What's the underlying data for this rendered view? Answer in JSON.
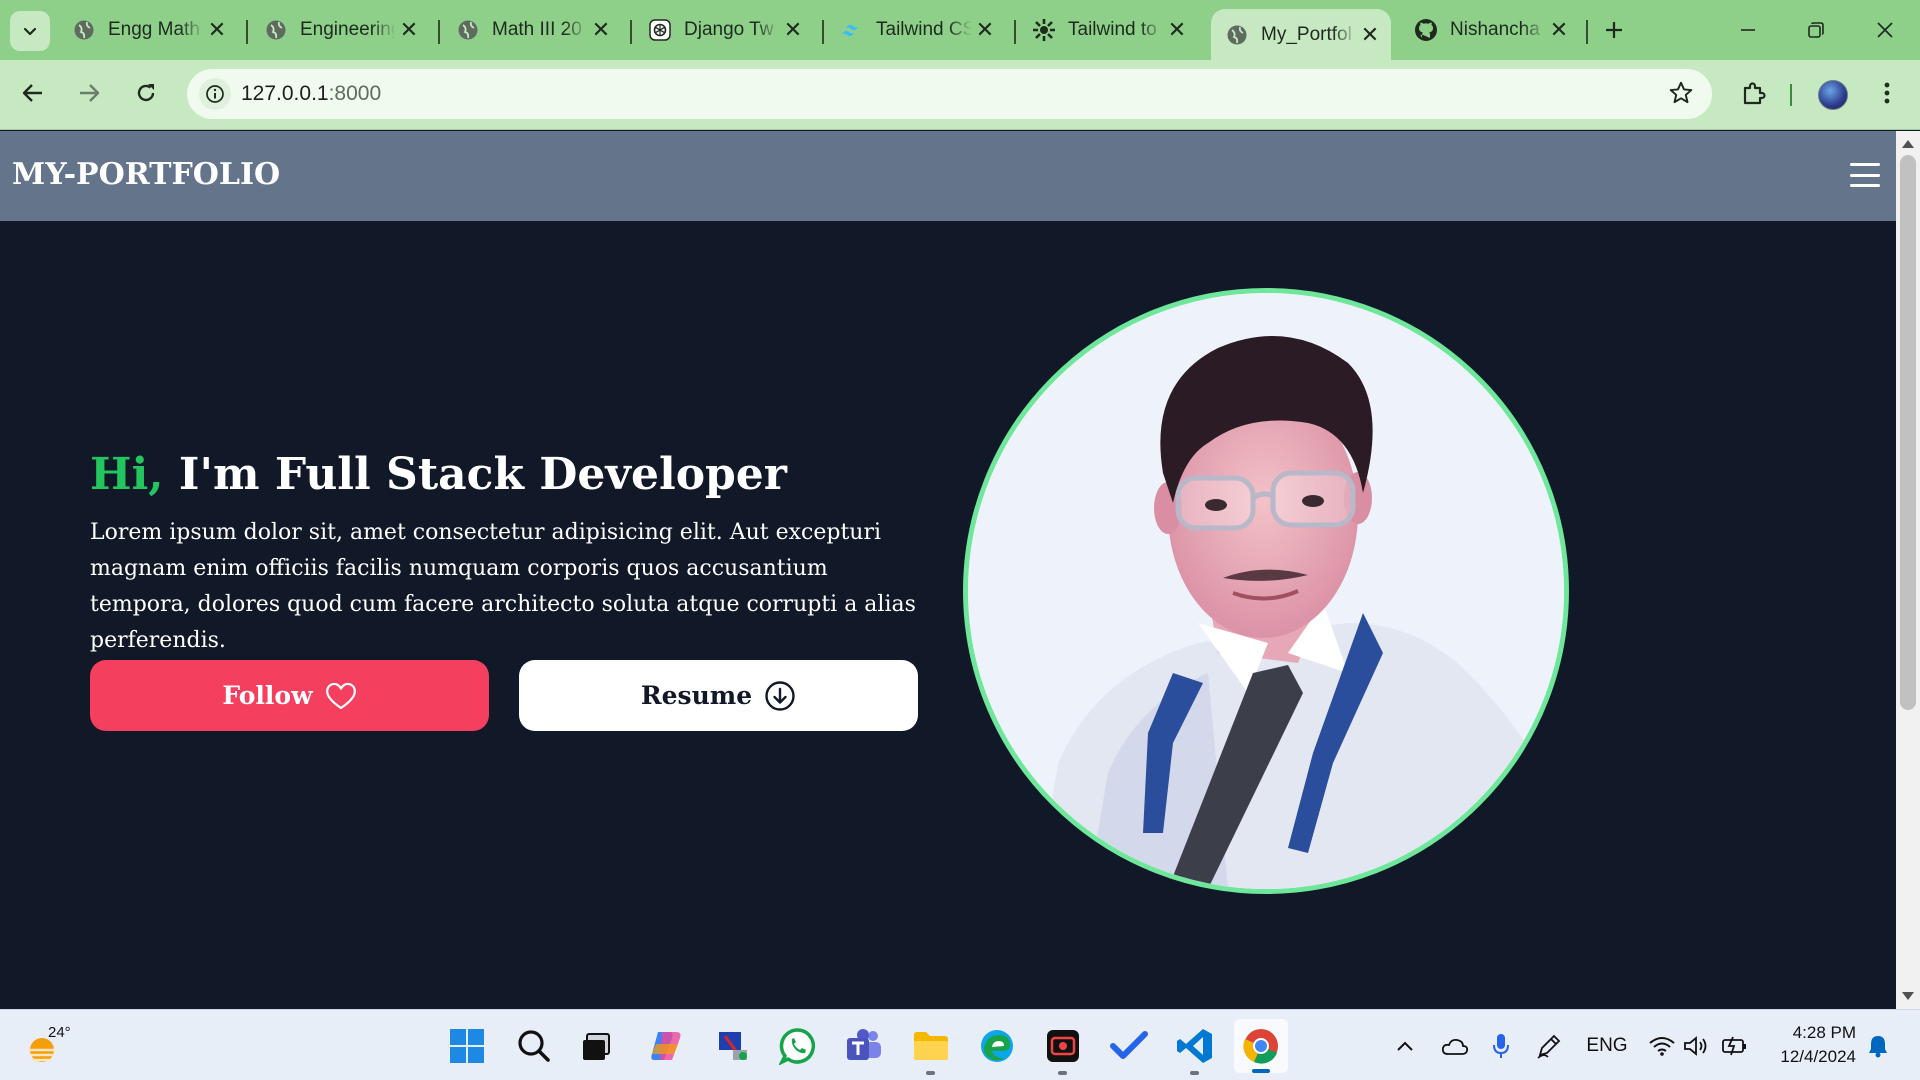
{
  "browser": {
    "tabs": [
      {
        "title": "Engg Math",
        "favicon": "globe-icon"
      },
      {
        "title": "Engineering",
        "favicon": "globe-icon"
      },
      {
        "title": "Math III 20",
        "favicon": "globe-icon"
      },
      {
        "title": "Django Tw",
        "favicon": "openai-icon"
      },
      {
        "title": "Tailwind CS",
        "favicon": "tailwind-icon"
      },
      {
        "title": "Tailwind to",
        "favicon": "gear-icon"
      },
      {
        "title": "My_Portfol",
        "favicon": "globe-icon",
        "active": true
      },
      {
        "title": "Nishancha",
        "favicon": "github-icon"
      }
    ],
    "url_host": "127.0.0.1",
    "url_port": ":8000",
    "accent": "#8ed08a"
  },
  "site": {
    "brand": "MY-PORTFOLIO",
    "nav_bg": "#64748b",
    "page_bg": "#111827"
  },
  "hero": {
    "greeting": "Hi,",
    "title": " I'm Full Stack Developer",
    "paragraph": "Lorem ipsum dolor sit, amet consectetur adipisicing elit. Aut excepturi magnam enim officiis facilis numquam corporis quos accusantium tempora, dolores quod cum facere architecto soluta atque corrupti a alias perferendis.",
    "follow_label": "Follow",
    "resume_label": "Resume",
    "greeting_color": "#22c55e",
    "follow_color": "#f43f5e",
    "ring_color": "#6ee79a"
  },
  "taskbar": {
    "temperature": "24°",
    "language": "ENG",
    "time": "4:28 PM",
    "date": "12/4/2024"
  }
}
